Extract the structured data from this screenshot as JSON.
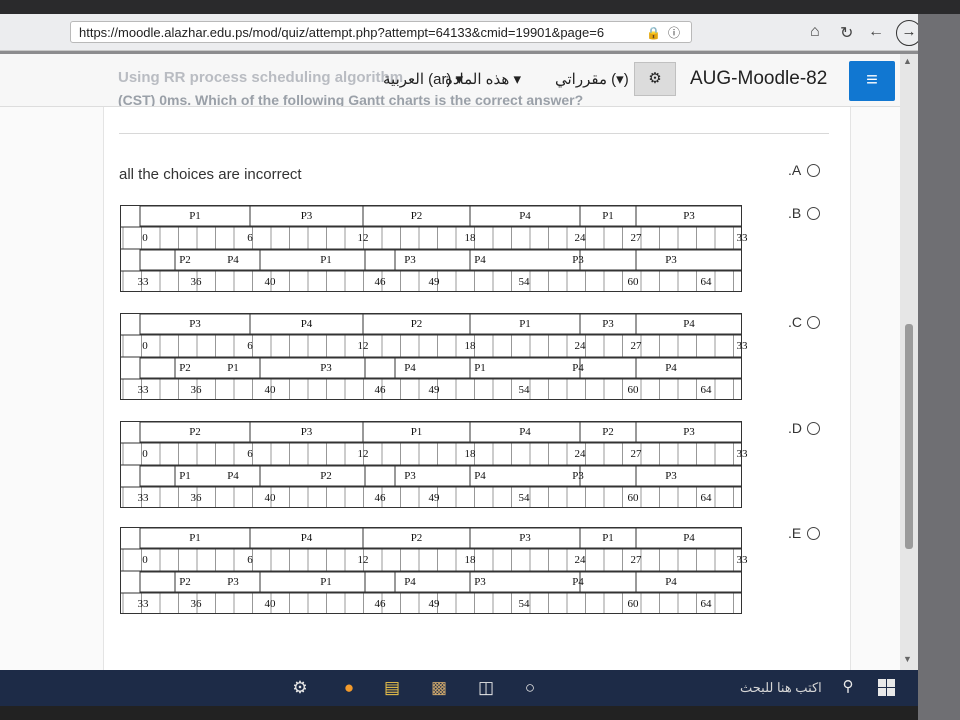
{
  "browser": {
    "url": "https://moodle.alazhar.edu.ps/mod/quiz/attempt.php?attempt=64133&cmid=19901&page=6",
    "lock_icon": "lock-icon",
    "info_icon": "info-icon",
    "home_icon": "home-icon",
    "refresh_icon": "refresh-icon",
    "back_icon": "←",
    "forward_icon": "→"
  },
  "header": {
    "site_title": "AUG-Moodle-82",
    "language_menu": "العربية (ar) ▾",
    "course_menu": "هذه المادة ▾",
    "my_courses": "مقرراتي (▾)",
    "settings_icon": "⚙",
    "menu_icon": "≡",
    "accent_color": "#1177d1"
  },
  "question": {
    "text_line1": "Using RR process scheduling algorithm",
    "text_line2": "(CST) 0ms. Which of the following Gantt charts is the correct answer?"
  },
  "options": [
    {
      "label": ".A",
      "text": "all the choices are incorrect",
      "chart": null
    },
    {
      "label": ".B",
      "chart": {
        "row1_names": [
          "P1",
          "P3",
          "P2",
          "P4",
          "P1",
          "P3"
        ],
        "row1_times": [
          "0",
          "6",
          "12",
          "18",
          "24",
          "27",
          "33"
        ],
        "row2_names": [
          "P2",
          "P4",
          "P1",
          "P3",
          "P4",
          "P3",
          "P3"
        ],
        "row2_times": [
          "33",
          "36",
          "40",
          "46",
          "49",
          "54",
          "60",
          "64"
        ]
      }
    },
    {
      "label": ".C",
      "chart": {
        "row1_names": [
          "P3",
          "P4",
          "P2",
          "P1",
          "P3",
          "P4"
        ],
        "row1_times": [
          "0",
          "6",
          "12",
          "18",
          "24",
          "27",
          "33"
        ],
        "row2_names": [
          "P2",
          "P1",
          "P3",
          "P4",
          "P1",
          "P4",
          "P4"
        ],
        "row2_times": [
          "33",
          "36",
          "40",
          "46",
          "49",
          "54",
          "60",
          "64"
        ]
      }
    },
    {
      "label": ".D",
      "chart": {
        "row1_names": [
          "P2",
          "P3",
          "P1",
          "P4",
          "P2",
          "P3"
        ],
        "row1_times": [
          "0",
          "6",
          "12",
          "18",
          "24",
          "27",
          "33"
        ],
        "row2_names": [
          "P1",
          "P4",
          "P2",
          "P3",
          "P4",
          "P3",
          "P3"
        ],
        "row2_times": [
          "33",
          "36",
          "40",
          "46",
          "49",
          "54",
          "60",
          "64"
        ]
      }
    },
    {
      "label": ".E",
      "chart": {
        "row1_names": [
          "P1",
          "P4",
          "P2",
          "P3",
          "P1",
          "P4"
        ],
        "row1_times": [
          "0",
          "6",
          "12",
          "18",
          "24",
          "27",
          "33"
        ],
        "row2_names": [
          "P2",
          "P3",
          "P1",
          "P4",
          "P3",
          "P4",
          "P4"
        ],
        "row2_times": [
          "33",
          "36",
          "40",
          "46",
          "49",
          "54",
          "60",
          "64"
        ]
      }
    }
  ],
  "taskbar": {
    "search_placeholder": "اكتب هنا للبحث",
    "icons": [
      "settings-icon",
      "firefox-icon",
      "file-explorer-icon",
      "photos-icon",
      "task-view-icon",
      "cortana-icon"
    ]
  }
}
